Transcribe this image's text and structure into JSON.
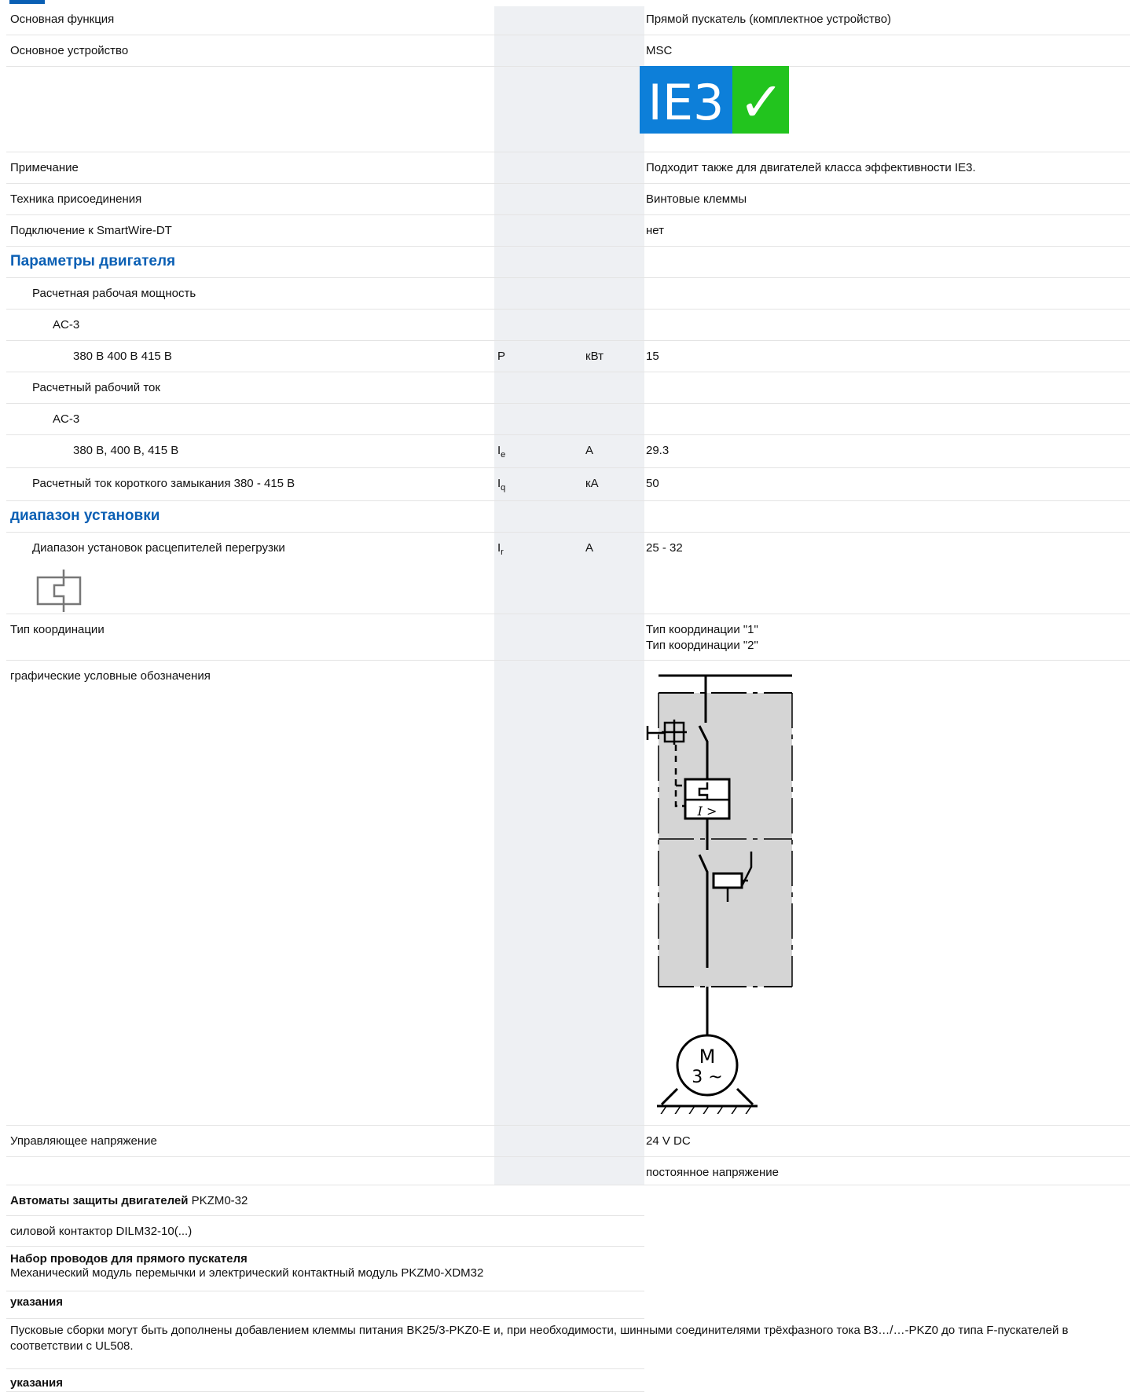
{
  "rows": {
    "main_function": {
      "label": "Основная функция",
      "value": "Прямой пускатель (комплектное устройство)"
    },
    "main_device": {
      "label": "Основное устройство",
      "value": "MSC"
    },
    "ie3_badge": {
      "text": "IE3",
      "check": "✓",
      "blue": "#0d7fd9",
      "green": "#22c41e"
    },
    "note": {
      "label": "Примечание",
      "value": "Подходит также для двигателей класса эффективности IE3."
    },
    "connection": {
      "label": "Техника присоединения",
      "value": "Винтовые клеммы"
    },
    "smartwire": {
      "label": "Подключение к SmartWire-DT",
      "value": "нет"
    },
    "motor_section": "Параметры двигателя",
    "rated_power": {
      "label": "Расчетная рабочая мощность"
    },
    "ac3_power": {
      "label": "AC-3"
    },
    "power_380": {
      "label": "380 В 400 В 415 В",
      "symbol": "P",
      "unit": "кВт",
      "value": "15"
    },
    "rated_current": {
      "label": "Расчетный рабочий ток"
    },
    "ac3_current": {
      "label": "AC-3"
    },
    "current_380": {
      "label": "380 В, 400 В, 415 В",
      "symbol": "I",
      "sub": "e",
      "unit": "A",
      "value": "29.3"
    },
    "short_circuit": {
      "label": "Расчетный ток короткого замыкания 380 - 415 В",
      "symbol": "I",
      "sub": "q",
      "unit": "кА",
      "value": "50"
    },
    "range_section": "диапазон установки",
    "overload": {
      "label": "Диапазон установок расцепителей перегрузки",
      "symbol": "I",
      "sub": "r",
      "unit": "A",
      "value": "25 - 32"
    },
    "coordination": {
      "label": "Тип координации",
      "value1": "Тип координации \"1\"",
      "value2": "Тип координации \"2\""
    },
    "symbols": {
      "label": "графические условные обозначения",
      "motor_letter": "M",
      "motor_phase": "3 ~",
      "trip_label": "I >"
    },
    "control_voltage": {
      "label": "Управляющее напряжение",
      "value": "24 V DC"
    },
    "dc": {
      "value": "постоянное напряжение"
    }
  },
  "components": {
    "breaker": {
      "bold": "Автоматы защиты двигателей",
      "text": " PKZM0-32"
    },
    "contactor": {
      "text": "силовой контактор DILM32-10(...)"
    },
    "wiring": {
      "bold": "Набор проводов для прямого пускателя",
      "text": "Механический модуль перемычки и электрический контактный модуль PKZM0-XDM32"
    },
    "notes1_title": "указания",
    "notes1_text": "Пусковые сборки могут быть дополнены добавлением клеммы питания BK25/3-PKZ0-E и, при необходимости, шинными соединителями трёхфазного тока B3…/…-PKZ0 до типа F-пускателей в соответствии с UL508.",
    "notes2_title": "указания"
  }
}
